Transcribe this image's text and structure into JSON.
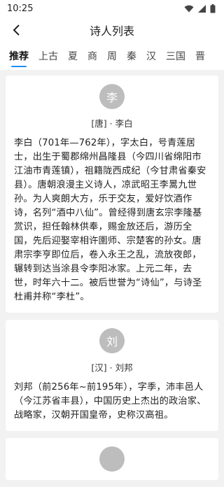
{
  "status_bar": {
    "time": "10:25"
  },
  "header": {
    "title": "诗人列表"
  },
  "tabs": [
    "推荐",
    "上古",
    "夏",
    "商",
    "周",
    "秦",
    "汉",
    "三国",
    "晋"
  ],
  "poets": [
    {
      "avatar": "李",
      "name": "[唐] · 李白",
      "desc": "李白（701年—762年），字太白，号青莲居士，出生于蜀郡绵州昌隆县（今四川省绵阳市江油市青莲镇），祖籍陇西成纪（今甘肃省秦安县）。唐朝浪漫主义诗人，凉武昭王李暠九世孙。为人爽朗大方，乐于交友，爱好饮酒作诗，名列“酒中八仙”。曾经得到唐玄宗李隆基赏识，担任翰林供奉，赐金放还后，游历全国，先后迎娶宰相许圉师、宗楚客的孙女。唐肃宗李亨即位后，卷入永王之乱，流放夜郎，辗转到达当涂县令李阳冰家。上元二年，去世，时年六十二。被后世誉为“诗仙”，与诗圣杜甫并称“李杜”。"
    },
    {
      "avatar": "刘",
      "name": "[汉] · 刘邦",
      "desc": "刘邦（前256年~前195年），字季，沛丰邑人（今江苏省丰县），中国历史上杰出的政治家、战略家，汉朝开国皇帝，史称汉高祖。"
    },
    {
      "avatar": "",
      "name": "",
      "desc": ""
    }
  ],
  "colors": {
    "accent": "#1f8ff5",
    "avatar_bg": "#bdbdbd",
    "background": "#f2f2f2"
  }
}
